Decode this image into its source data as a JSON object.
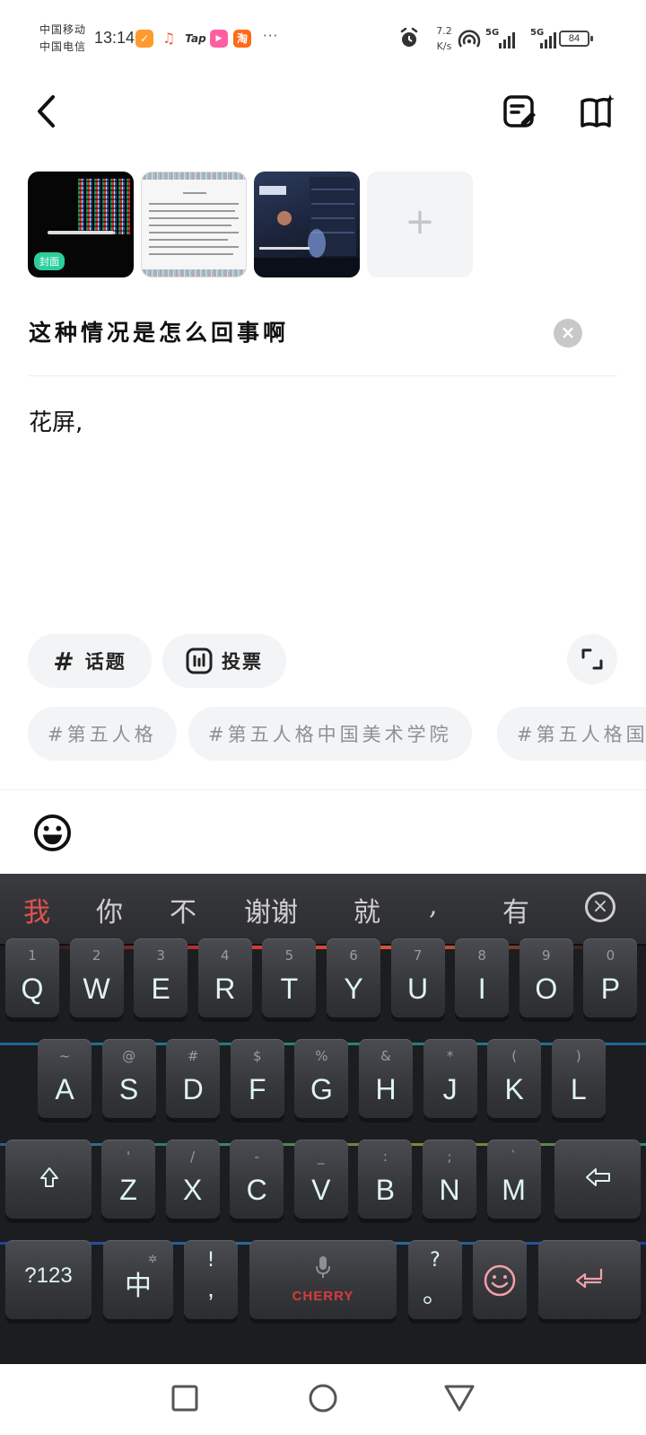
{
  "status_bar": {
    "carrier_1": "中国移动",
    "carrier_2": "中国电信",
    "time": "13:14",
    "app_icons": [
      "taobao-check-icon",
      "music-icon",
      "taptap-icon",
      "video-app-icon",
      "taobao-icon"
    ],
    "tap_label": "Tap",
    "taobao_label": "淘",
    "more": "···",
    "net_speed_value": "7.2",
    "net_speed_unit": "K/s",
    "signal_1_label": "5G",
    "signal_2_label": "5G",
    "battery": "84"
  },
  "header": {
    "back_icon": "chevron-left-icon",
    "draft_icon": "draft-edit-icon",
    "guide_icon": "book-sparkle-icon"
  },
  "images": {
    "cover_label": "封面",
    "add_label": "+"
  },
  "post": {
    "title": "这种情况是怎么回事啊",
    "body": "花屏,"
  },
  "actions": {
    "topic_label": "话题",
    "topic_icon": "#",
    "vote_label": "投票"
  },
  "suggested_tags": [
    "#第五人格",
    "#第五人格中国美术学院",
    "#第五人格国"
  ],
  "keyboard": {
    "candidates": [
      "我",
      "你",
      "不",
      "谢谢",
      "就",
      ",",
      "有"
    ],
    "row1": [
      {
        "main": "Q",
        "sub": "1"
      },
      {
        "main": "W",
        "sub": "2"
      },
      {
        "main": "E",
        "sub": "3"
      },
      {
        "main": "R",
        "sub": "4"
      },
      {
        "main": "T",
        "sub": "5"
      },
      {
        "main": "Y",
        "sub": "6"
      },
      {
        "main": "U",
        "sub": "7"
      },
      {
        "main": "I",
        "sub": "8"
      },
      {
        "main": "O",
        "sub": "9"
      },
      {
        "main": "P",
        "sub": "0"
      }
    ],
    "row2": [
      {
        "main": "A",
        "sub": "~"
      },
      {
        "main": "S",
        "sub": "@"
      },
      {
        "main": "D",
        "sub": "#"
      },
      {
        "main": "F",
        "sub": "$"
      },
      {
        "main": "G",
        "sub": "%"
      },
      {
        "main": "H",
        "sub": "&"
      },
      {
        "main": "J",
        "sub": "*"
      },
      {
        "main": "K",
        "sub": "("
      },
      {
        "main": "L",
        "sub": ")"
      }
    ],
    "row3": [
      {
        "main": "Z",
        "sub": "'"
      },
      {
        "main": "X",
        "sub": "/"
      },
      {
        "main": "C",
        "sub": "-"
      },
      {
        "main": "V",
        "sub": "_"
      },
      {
        "main": "B",
        "sub": ":"
      },
      {
        "main": "N",
        "sub": ";"
      },
      {
        "main": "M",
        "sub": "`"
      }
    ],
    "numbers_key": "?123",
    "lang_key": "中",
    "comma_key_main": ",",
    "comma_key_sub": "!",
    "space_brand": "CHERRY",
    "period_key_main": "。",
    "period_key_sub": "?"
  },
  "colors": {
    "accent_green": "#2bcf9c",
    "candidate_highlight": "#e0524d",
    "brand_red": "#d83b3b"
  }
}
